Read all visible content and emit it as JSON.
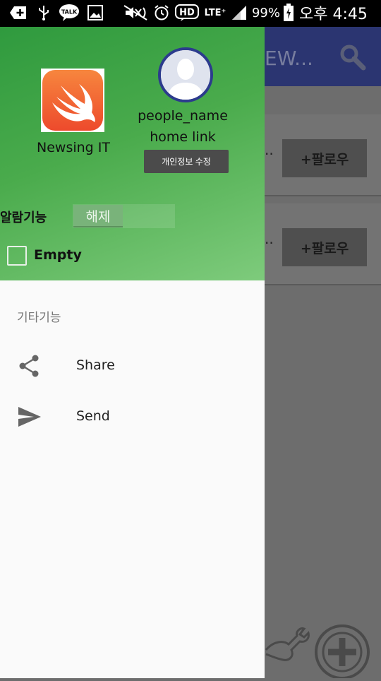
{
  "status_bar": {
    "battery": "99%",
    "time": "오후 4:45",
    "lte": "LTE⁺",
    "hd": "HD",
    "talk": "TALK",
    "icons": [
      "plus-icon",
      "usb-icon",
      "kakaotalk-icon",
      "image-icon",
      "mute-icon",
      "alarm-icon",
      "hd-icon",
      "lte-icon",
      "signal-icon",
      "battery-icon"
    ]
  },
  "background_app": {
    "title_fragment": "EW...",
    "cards": [
      {
        "text": "..",
        "follow_label": "+팔로우"
      },
      {
        "text": "..",
        "follow_label": "+팔로우"
      }
    ],
    "colors": {
      "appbar": "#2b3571"
    }
  },
  "drawer": {
    "app_name": "Newsing IT",
    "profile": {
      "name": "people_name",
      "home_link": "home link",
      "edit_button": "개인정보 수정"
    },
    "alarm": {
      "label": "알람기능",
      "toggle_text": "해제",
      "state": "off"
    },
    "empty_checkbox": {
      "label": "Empty",
      "checked": false
    },
    "section_title": "기타기능",
    "menu": [
      {
        "icon": "share-icon",
        "label": "Share"
      },
      {
        "icon": "send-icon",
        "label": "Send"
      }
    ],
    "colors": {
      "header_start": "#2f9a3e",
      "header_end": "#7ecb7c"
    }
  }
}
